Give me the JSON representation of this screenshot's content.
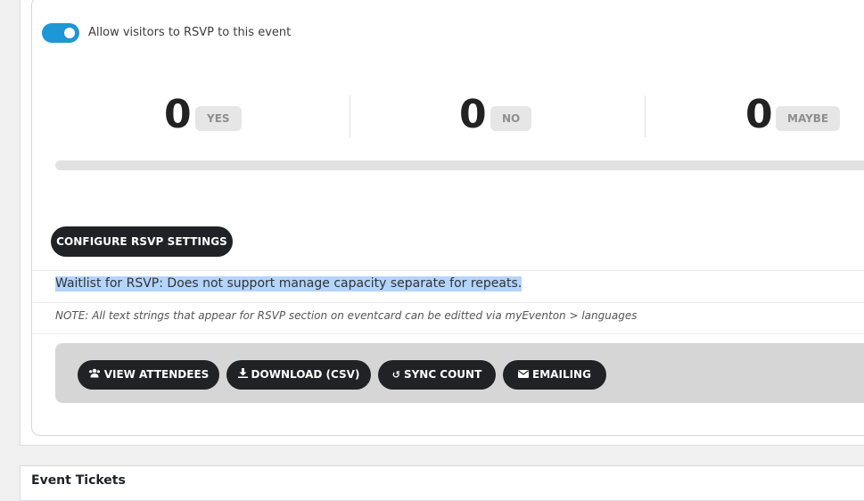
{
  "rsvp": {
    "toggle_label": "Allow visitors to RSVP to this event",
    "toggle_on": true,
    "stats": [
      {
        "count": "0",
        "label": "YES"
      },
      {
        "count": "0",
        "label": "NO"
      },
      {
        "count": "0",
        "label": "MAYBE"
      }
    ],
    "configure_label": "CONFIGURE RSVP SETTINGS",
    "waitlist_note": "Waitlist for RSVP: Does not support manage capacity separate for repeats.",
    "strings_note": "NOTE: All text strings that appear for RSVP section on eventcard can be editted via myEventon > languages",
    "actions": {
      "view_attendees": "VIEW ATTENDEES",
      "download_csv": "DOWNLOAD (CSV)",
      "sync_count": "SYNC COUNT",
      "emailing": "EMAILING"
    }
  },
  "tickets": {
    "title": "Event Tickets"
  },
  "colors": {
    "accent": "#1e97d6",
    "button_dark": "#202226",
    "badge_bg": "#e6e6e6",
    "selection": "#b3d4fc"
  },
  "icons": {
    "view_attendees": "users-icon",
    "download_csv": "download-icon",
    "sync_count": "refresh-icon",
    "emailing": "envelope-icon"
  }
}
